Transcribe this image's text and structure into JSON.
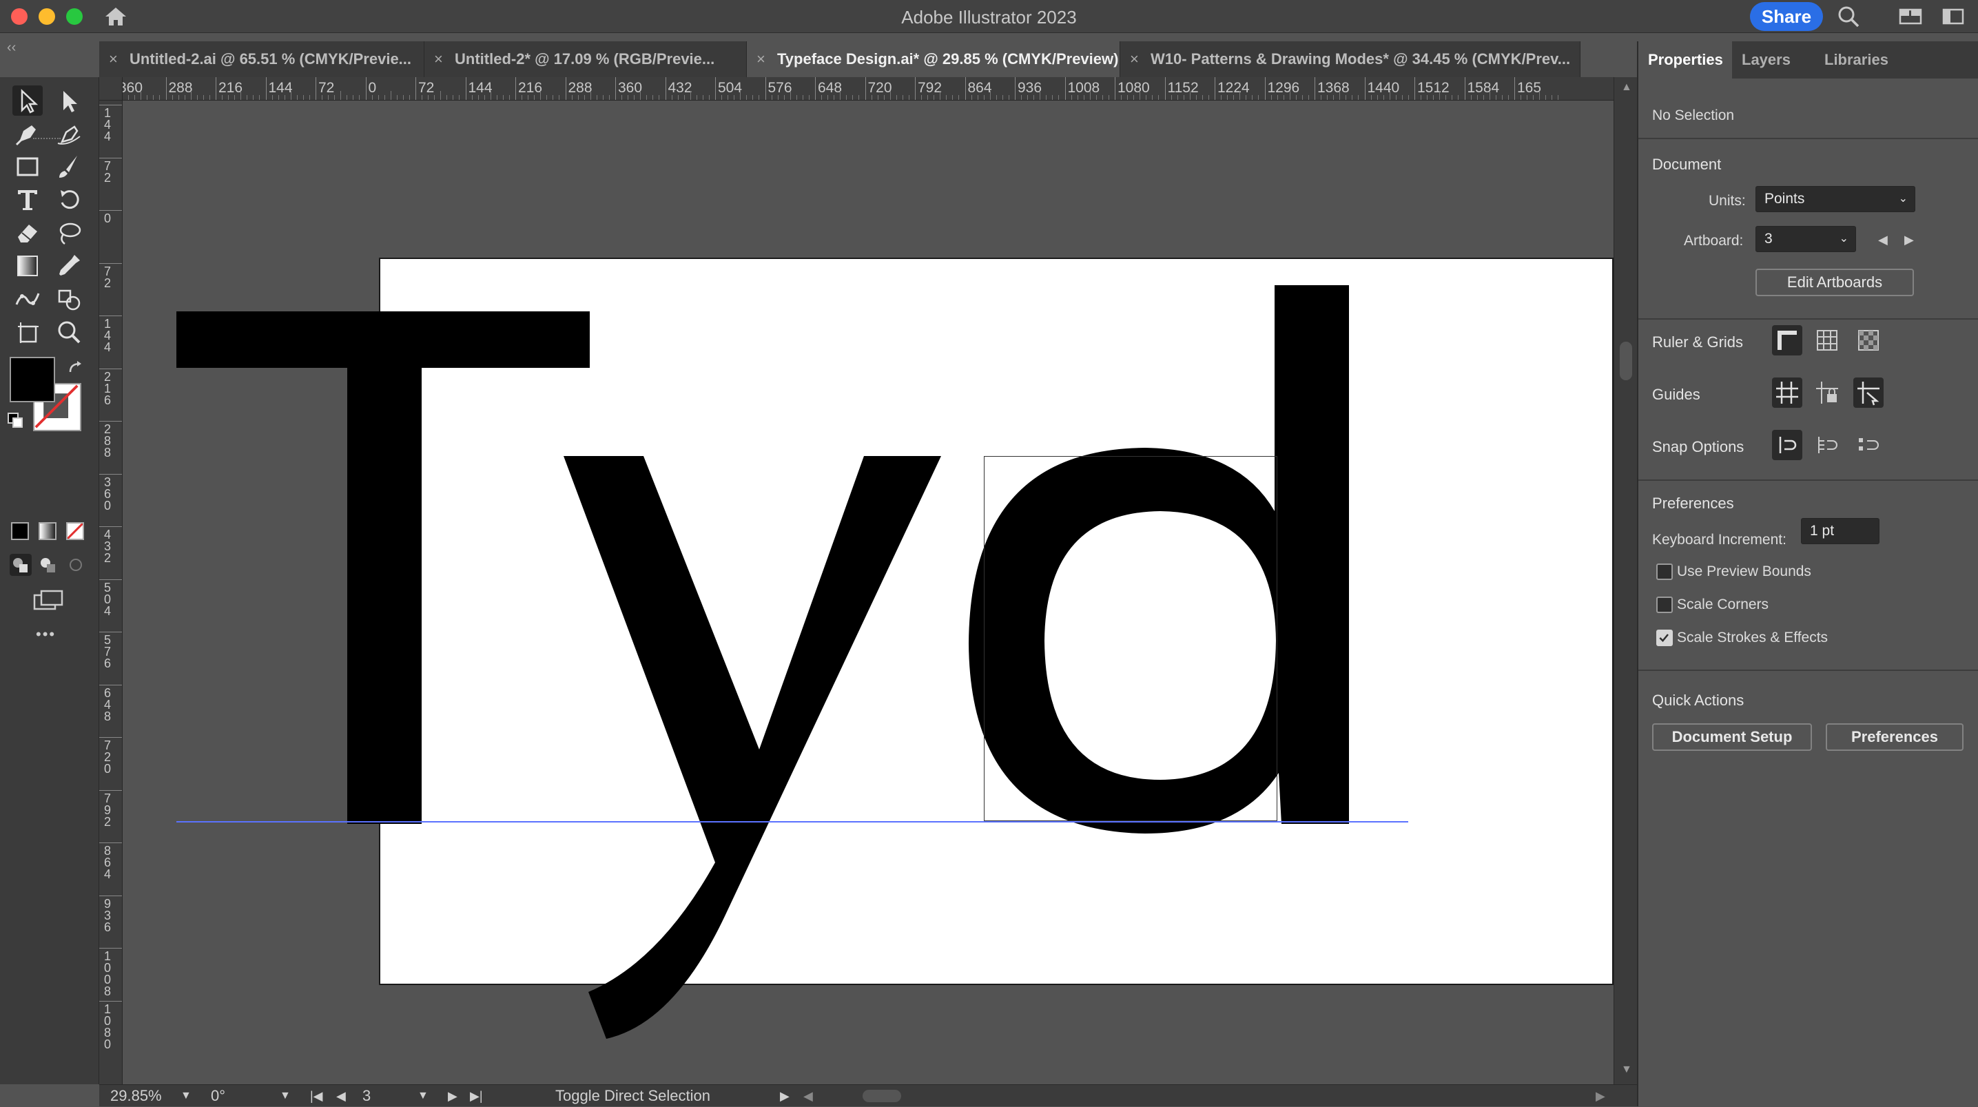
{
  "app": {
    "title": "Adobe Illustrator 2023",
    "share_label": "Share"
  },
  "colors": {
    "accent": "#2a6ee6",
    "guide": "#3d63ff",
    "close": "#ff5f57",
    "minimize": "#febc2e",
    "maximize": "#28c840"
  },
  "tabs": [
    {
      "label": "Untitled-2.ai @ 65.51 % (CMYK/Previe...",
      "active": false
    },
    {
      "label": "Untitled-2* @ 17.09 % (RGB/Previe...",
      "active": false
    },
    {
      "label": "Typeface Design.ai* @ 29.85 % (CMYK/Preview)",
      "active": true
    },
    {
      "label": "W10- Patterns & Drawing Modes* @ 34.45 % (CMYK/Prev...",
      "active": false
    }
  ],
  "tab_close_glyph": "×",
  "collapse_left": "‹‹",
  "collapse_right": "››",
  "ruler_h": [
    "360",
    "288",
    "216",
    "144",
    "72",
    "0",
    "72",
    "144",
    "216",
    "288",
    "360",
    "432",
    "504",
    "576",
    "648",
    "720",
    "792",
    "864",
    "936",
    "1008",
    "1080",
    "1152",
    "1224",
    "1296",
    "1368",
    "1440",
    "1512",
    "1584",
    "165"
  ],
  "ruler_v": [
    "144",
    "72",
    "0",
    "72",
    "144",
    "216",
    "288",
    "360",
    "432",
    "504",
    "576",
    "648",
    "720",
    "792",
    "864",
    "936",
    "1008",
    "1080"
  ],
  "toolbar": {
    "tools": [
      "selection-icon",
      "direct-selection-icon",
      "pen-icon",
      "curvature-icon",
      "rectangle-icon",
      "paintbrush-icon",
      "type-icon",
      "rotate-icon",
      "eraser-icon",
      "lasso-icon",
      "gradient-icon",
      "eyedropper-icon",
      "puppet-warp-icon",
      "shape-builder-icon",
      "artboard-icon",
      "zoom-icon"
    ],
    "more": "•••",
    "fill_color": "#000000"
  },
  "artboard": {
    "glyphs": "Tyd"
  },
  "status": {
    "zoom": "29.85%",
    "rotation": "0°",
    "artboard": "3",
    "tool_hint": "Toggle Direct Selection"
  },
  "panel": {
    "tabs": [
      "Properties",
      "Layers",
      "Libraries"
    ],
    "selection": "No Selection",
    "document_heading": "Document",
    "units_label": "Units:",
    "units_value": "Points",
    "artboard_label": "Artboard:",
    "artboard_value": "3",
    "edit_artboards": "Edit Artboards",
    "ruler_grids": "Ruler & Grids",
    "guides": "Guides",
    "snap_options": "Snap Options",
    "preferences_heading": "Preferences",
    "keyboard_increment_label": "Keyboard Increment:",
    "keyboard_increment_value": "1 pt",
    "checkboxes": [
      {
        "label": "Use Preview Bounds",
        "checked": false
      },
      {
        "label": "Scale Corners",
        "checked": false
      },
      {
        "label": "Scale Strokes & Effects",
        "checked": true
      }
    ],
    "quick_actions": "Quick Actions",
    "document_setup": "Document Setup",
    "preferences_button": "Preferences"
  }
}
